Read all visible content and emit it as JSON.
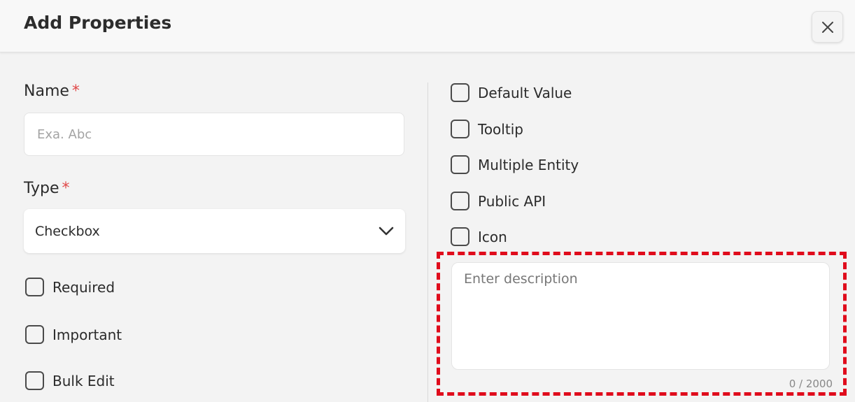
{
  "dialog": {
    "title": "Add Properties",
    "close_icon": "close-icon"
  },
  "form": {
    "name": {
      "label": "Name",
      "required_mark": "*",
      "placeholder": "Exa. Abc",
      "value": ""
    },
    "type": {
      "label": "Type",
      "required_mark": "*",
      "selected": "Checkbox",
      "icon": "chevron-down-icon"
    },
    "left_options": [
      {
        "label": "Required",
        "checked": false
      },
      {
        "label": "Important",
        "checked": false
      },
      {
        "label": "Bulk Edit",
        "checked": false
      }
    ],
    "right_options": [
      {
        "label": "Default Value",
        "checked": false
      },
      {
        "label": "Tooltip",
        "checked": false
      },
      {
        "label": "Multiple Entity",
        "checked": false
      },
      {
        "label": "Public API",
        "checked": false
      },
      {
        "label": "Icon",
        "checked": false
      }
    ],
    "description": {
      "placeholder": "Enter description",
      "value": "",
      "counter": "0 / 2000"
    }
  },
  "colors": {
    "required": "#e04848",
    "highlight": "#e00c1c"
  }
}
